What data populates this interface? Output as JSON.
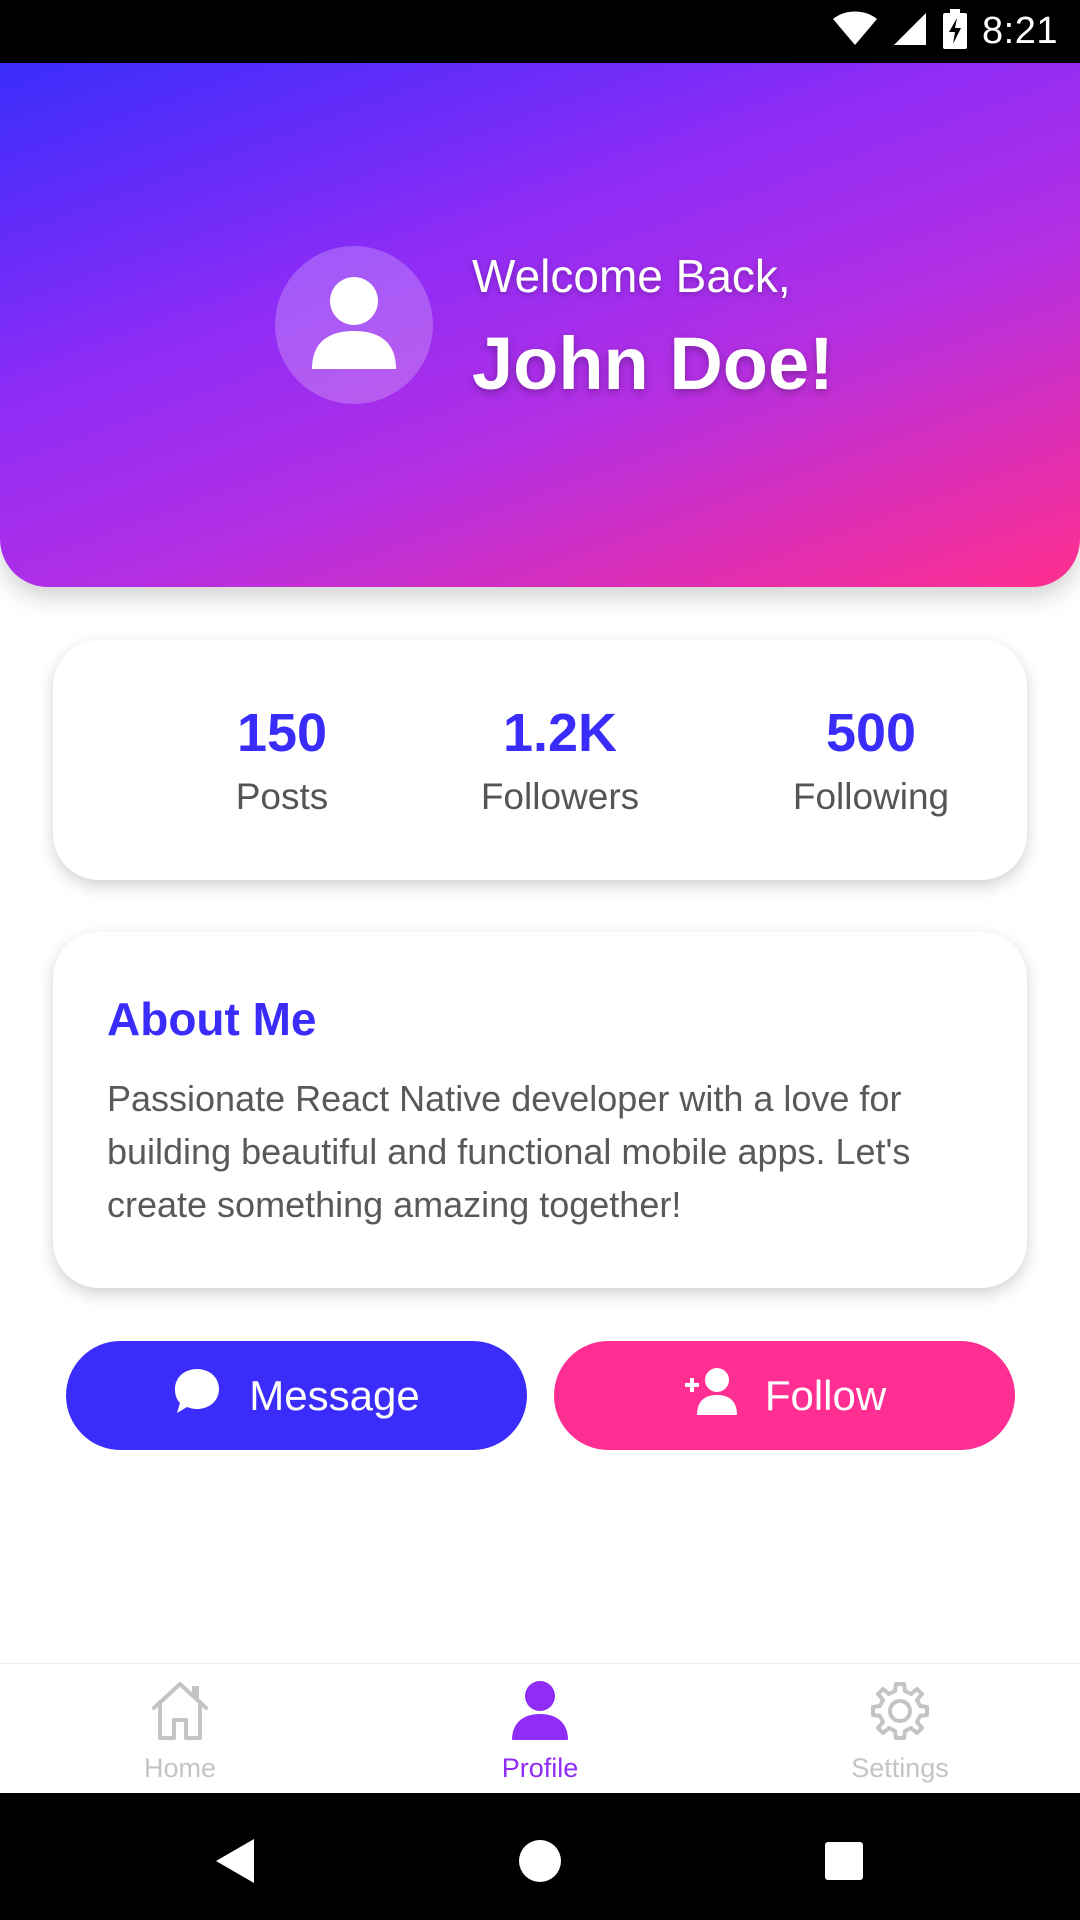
{
  "status_bar": {
    "time": "8:21",
    "icons": [
      "wifi-icon",
      "signal-icon",
      "battery-charging-icon"
    ]
  },
  "header": {
    "greeting": "Welcome Back,",
    "name": "John Doe!",
    "avatar_icon": "user-icon",
    "gradient": [
      "#3a2dfb",
      "#8f2cf6",
      "#ff2e8e"
    ]
  },
  "stats": [
    {
      "value": "150",
      "label": "Posts"
    },
    {
      "value": "1.2K",
      "label": "Followers"
    },
    {
      "value": "500",
      "label": "Following"
    }
  ],
  "about": {
    "title": "About Me",
    "text": "Passionate React Native developer with a love for building beautiful and functional mobile apps. Let's create something amazing together!"
  },
  "actions": {
    "message": {
      "label": "Message",
      "icon": "chat-bubble-icon",
      "color": "#3a2dfb"
    },
    "follow": {
      "label": "Follow",
      "icon": "add-user-icon",
      "color": "#ff2e93"
    }
  },
  "bottom_nav": {
    "items": [
      {
        "label": "Home",
        "icon": "home-icon",
        "active": false
      },
      {
        "label": "Profile",
        "icon": "profile-icon",
        "active": true
      },
      {
        "label": "Settings",
        "icon": "gear-icon",
        "active": false
      }
    ],
    "active_color": "#8f2cf6",
    "inactive_color": "#c4c4c4"
  },
  "system_nav": {
    "buttons": [
      "back-icon",
      "home-circle-icon",
      "recents-icon"
    ]
  }
}
